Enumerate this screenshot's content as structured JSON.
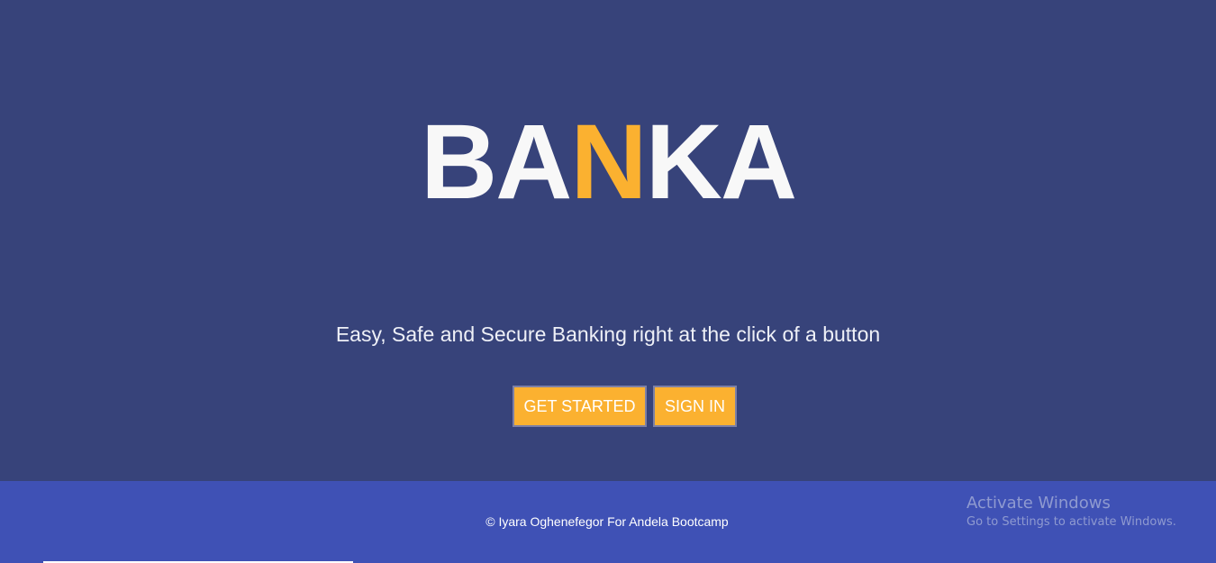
{
  "brand": {
    "logo_part1": "BA",
    "logo_accent": "N",
    "logo_part2": "KA",
    "accent_color": "#fbb130",
    "background_color": "#37437a"
  },
  "hero": {
    "tagline": "Easy, Safe and Secure Banking right at the click of a button"
  },
  "actions": {
    "get_started_label": "GET STARTED",
    "sign_in_label": "SIGN IN"
  },
  "footer": {
    "copyright": "© Iyara Oghenefegor For Andela Bootcamp",
    "background_color": "#3f51b5"
  },
  "windows_watermark": {
    "title": "Activate Windows",
    "subtitle": "Go to Settings to activate Windows."
  }
}
